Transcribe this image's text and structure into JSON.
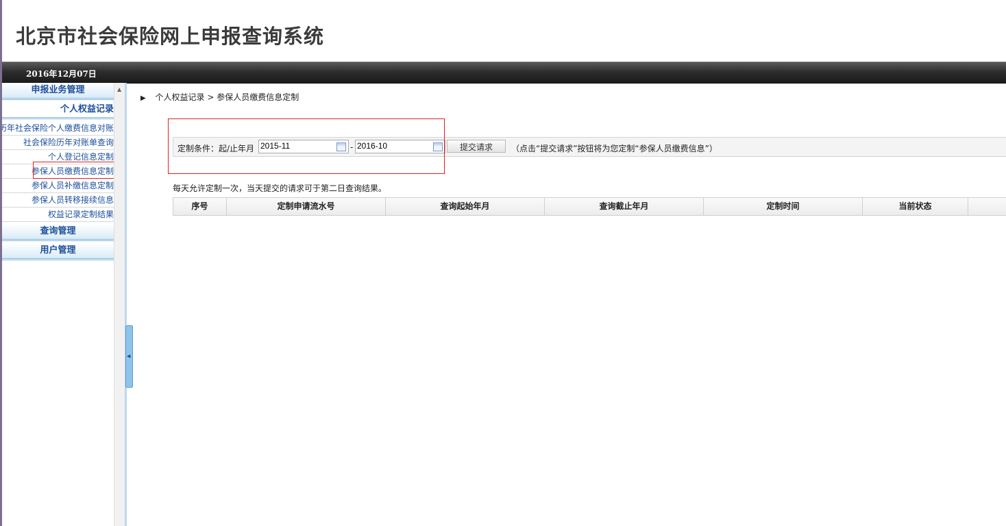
{
  "header": {
    "system_title": "北京市社会保险网上申报查询系统",
    "date": "2016年12月07日"
  },
  "sidebar": {
    "sections": [
      {
        "label": "申报业务管理"
      },
      {
        "label": "个人权益记录"
      },
      {
        "label": "查询管理"
      },
      {
        "label": "用户管理"
      }
    ],
    "items": [
      {
        "label": "历年社会保险个人缴费信息对账"
      },
      {
        "label": "社会保险历年对账单查询"
      },
      {
        "label": "个人登记信息定制"
      },
      {
        "label": "参保人员缴费信息定制"
      },
      {
        "label": "参保人员补缴信息定制"
      },
      {
        "label": "参保人员转移接续信息"
      },
      {
        "label": "权益记录定制结果"
      }
    ],
    "active_item": "参保人员缴费信息定制"
  },
  "breadcrumb": {
    "level1": "个人权益记录",
    "separator": ">",
    "level2": "参保人员缴费信息定制"
  },
  "form": {
    "condition_label": "定制条件：起/止年月",
    "start_month": "2015-11",
    "end_month": "2016-10",
    "range_separator": "-",
    "submit_label": "提交请求",
    "hint": "（点击“提交请求”按钮将为您定制“参保人员缴费信息”）"
  },
  "notice": "每天允许定制一次，当天提交的请求可于第二日查询结果。",
  "table": {
    "columns": [
      "序号",
      "定制申请流水号",
      "查询起始年月",
      "查询截止年月",
      "定制时间",
      "当前状态",
      ""
    ]
  },
  "colors": {
    "menu_text": "#1d4f9b",
    "highlight_border": "#e02020",
    "header_bar": "#2c2c2c"
  }
}
